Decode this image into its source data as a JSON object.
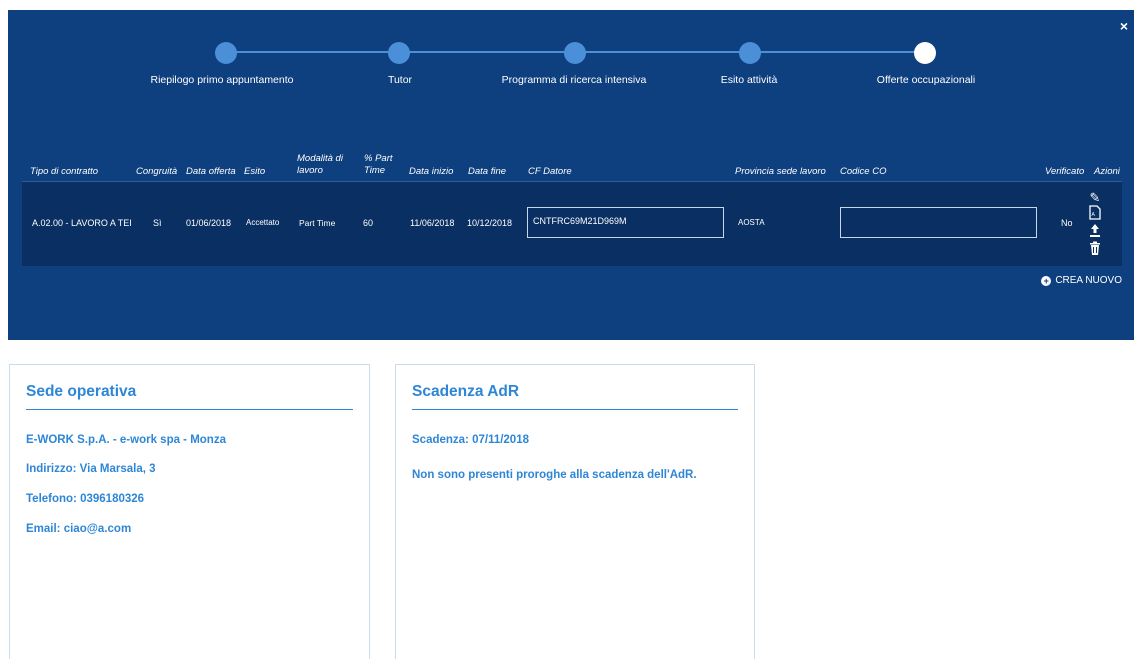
{
  "stepper": {
    "steps": [
      "Riepilogo primo appuntamento",
      "Tutor",
      "Programma di ricerca intensiva",
      "Esito attività",
      "Offerte occupazionali"
    ]
  },
  "close_label": "×",
  "table": {
    "headers": {
      "tipo_contratto": "Tipo di contratto",
      "congruita": "Congruità",
      "data_offerta": "Data offerta",
      "esito": "Esito",
      "modalita": "Modalità di lavoro",
      "part_time": "% Part Time",
      "data_inizio": "Data inizio",
      "data_fine": "Data fine",
      "cf_datore": "CF Datore",
      "provincia": "Provincia sede lavoro",
      "codice_co": "Codice CO",
      "verificato": "Verificato",
      "azioni": "Azioni"
    },
    "row": {
      "tipo_contratto": "A.02.00 - LAVORO A TEI",
      "congruita": "Sì",
      "data_offerta": "01/06/2018",
      "esito": "Accettato",
      "modalita": "Part Time",
      "part_time": "60",
      "data_inizio": "11/06/2018",
      "data_fine": "10/12/2018",
      "cf_datore": "CNTFRC69M21D969M",
      "provincia": "AOSTA",
      "codice_co": "",
      "verificato": "No"
    },
    "actions": {
      "edit": "edit-icon",
      "pdf": "pdf-icon",
      "upload": "upload-icon",
      "delete": "trash-icon"
    }
  },
  "create_new_label": "CREA NUOVO",
  "sede_operativa": {
    "title": "Sede operativa",
    "azienda": "E-WORK S.p.A. - e-work spa - Monza",
    "indirizzo": "Indirizzo: Via Marsala, 3",
    "telefono": "Telefono: 0396180326",
    "email": "Email: ciao@a.com"
  },
  "scadenza_adr": {
    "title": "Scadenza AdR",
    "scadenza": "Scadenza: 07/11/2018",
    "proroghe": "Non sono presenti proroghe alla scadenza dell'AdR."
  },
  "colors": {
    "panel": "#0e3f7e",
    "row": "#0a2f62",
    "accent": "#2e86d6",
    "step": "#4a8fd8"
  }
}
